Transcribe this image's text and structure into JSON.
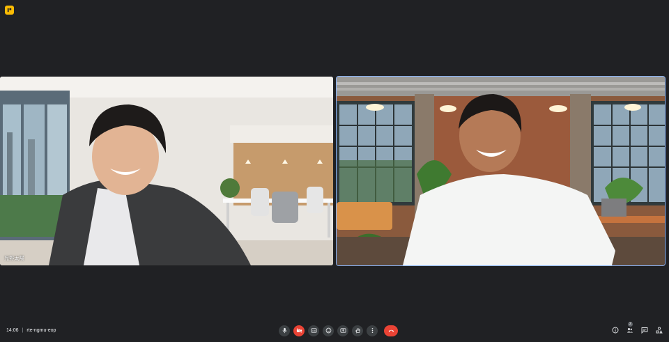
{
  "participants": [
    {
      "name": "児野太陽"
    },
    {
      "name": ""
    }
  ],
  "meeting": {
    "time": "14:06",
    "separator": "|",
    "code": "rte-ngmu-eop"
  },
  "controls": [
    {
      "icon": "mic-icon",
      "label": "microphone"
    },
    {
      "icon": "camera-off-icon",
      "label": "camera"
    },
    {
      "icon": "captions-icon",
      "label": "captions"
    },
    {
      "icon": "emoji-icon",
      "label": "reactions"
    },
    {
      "icon": "present-icon",
      "label": "present"
    },
    {
      "icon": "raise-hand-icon",
      "label": "raise hand"
    },
    {
      "icon": "more-options-icon",
      "label": "more options"
    },
    {
      "icon": "end-call-icon",
      "label": "leave call"
    }
  ],
  "people_count": "2",
  "colors": {
    "background": "#202124",
    "accent_red": "#ea4335",
    "active_speaker": "#8ab4f8",
    "app_badge": "#fbbc04"
  }
}
